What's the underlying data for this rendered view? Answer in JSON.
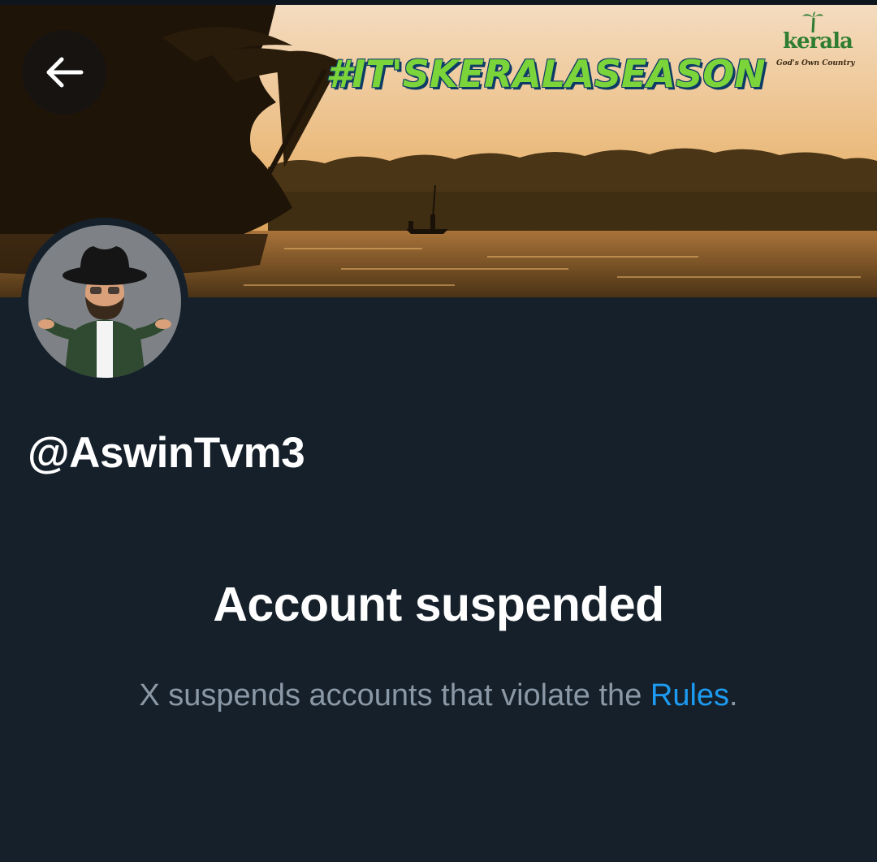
{
  "header": {
    "back_icon": "arrow-left-icon",
    "banner_hashtag": "#IT'SKERALASEASON",
    "banner_brand": "kerala",
    "banner_brand_tagline": "God's Own Country"
  },
  "profile": {
    "handle": "@AswinTvm3",
    "avatar_icon": "cowboy-avatar"
  },
  "notice": {
    "title": "Account suspended",
    "text_before": "X suspends accounts that violate the ",
    "link_label": "Rules",
    "text_after": "."
  },
  "colors": {
    "background": "#15202b",
    "link": "#1d9bf0",
    "muted_text": "#8b98a5"
  }
}
